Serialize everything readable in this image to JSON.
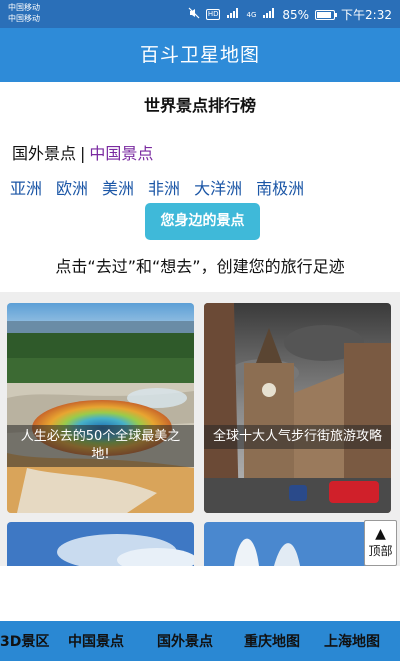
{
  "status_bar": {
    "carrier_1": "中国移动",
    "carrier_2": "中国移动",
    "hd": "HD",
    "signal_label": "4G",
    "battery_text": "85%",
    "battery_level": 0.85,
    "time": "下午2:32"
  },
  "app_bar": {
    "title": "百斗卫星地图"
  },
  "ranking": {
    "title": "世界景点排行榜",
    "scope_foreign": "国外景点",
    "scope_separator": "|",
    "scope_china": "中国景点",
    "continents": [
      "亚洲",
      "欧洲",
      "美洲",
      "非洲",
      "大洋洲",
      "南极洲"
    ],
    "nearby_button": "您身边的景点",
    "slogan": "点击“去过”和“想去”，创建您的旅行足迹"
  },
  "cards": [
    {
      "caption": "人生必去的50个全球最美之地!"
    },
    {
      "caption": "全球十大人气步行街旅游攻略"
    }
  ],
  "back_to_top": {
    "arrow": "▲",
    "label": "顶部"
  },
  "bottom_tabs": [
    "3D景区",
    "中国景点",
    "国外景点",
    "重庆地图",
    "上海地图"
  ]
}
